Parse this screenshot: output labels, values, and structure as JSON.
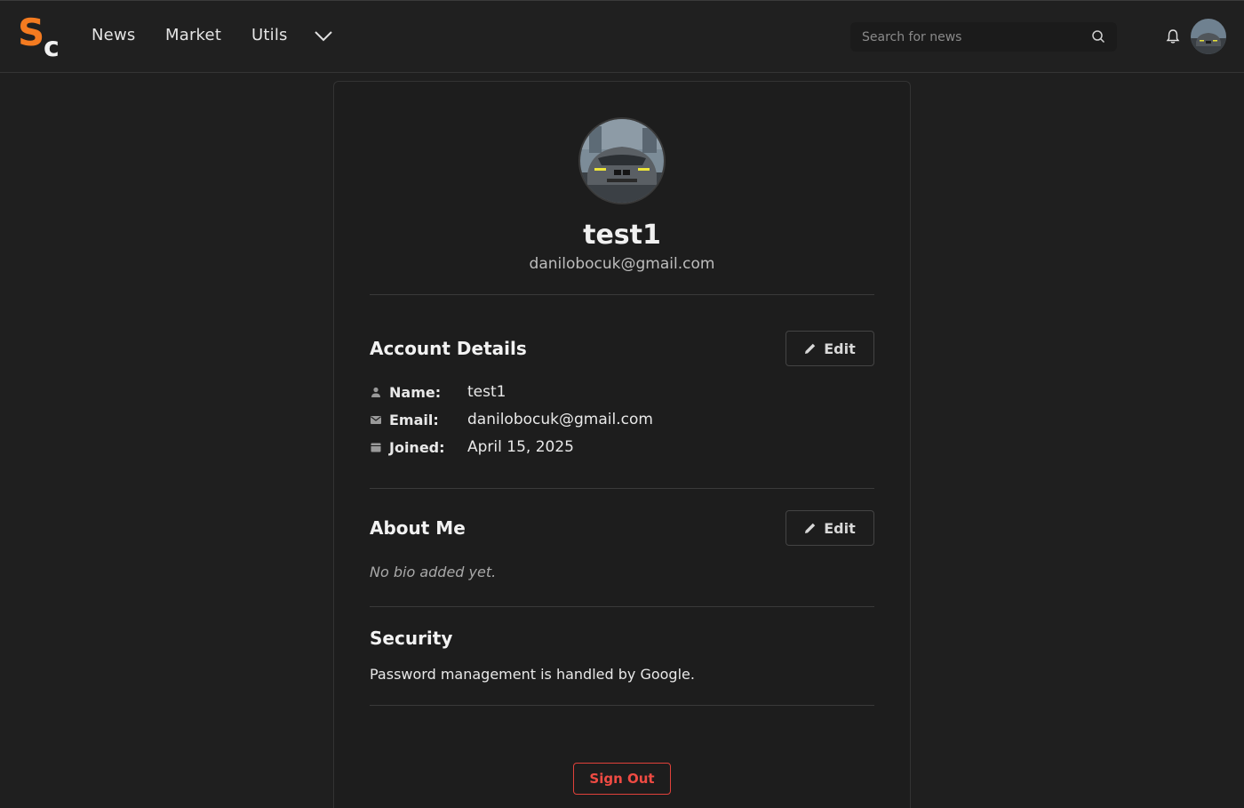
{
  "header": {
    "logo_letters": "SC",
    "nav": [
      "News",
      "Market",
      "Utils"
    ],
    "search_placeholder": "Search for news"
  },
  "profile": {
    "username": "test1",
    "email": "danilobocuk@gmail.com"
  },
  "account_details": {
    "title": "Account Details",
    "edit_label": "Edit",
    "rows": [
      {
        "icon": "user-icon",
        "label": "Name:",
        "value": "test1"
      },
      {
        "icon": "mail-icon",
        "label": "Email:",
        "value": "danilobocuk@gmail.com"
      },
      {
        "icon": "calendar-icon",
        "label": "Joined:",
        "value": "April 15, 2025"
      }
    ]
  },
  "about": {
    "title": "About Me",
    "edit_label": "Edit",
    "empty_text": "No bio added yet."
  },
  "security": {
    "title": "Security",
    "text": "Password management is handled by Google."
  },
  "signout_label": "Sign Out",
  "colors": {
    "accent": "#f47b20",
    "danger": "#ef4b43",
    "background": "#1f1f1f"
  }
}
